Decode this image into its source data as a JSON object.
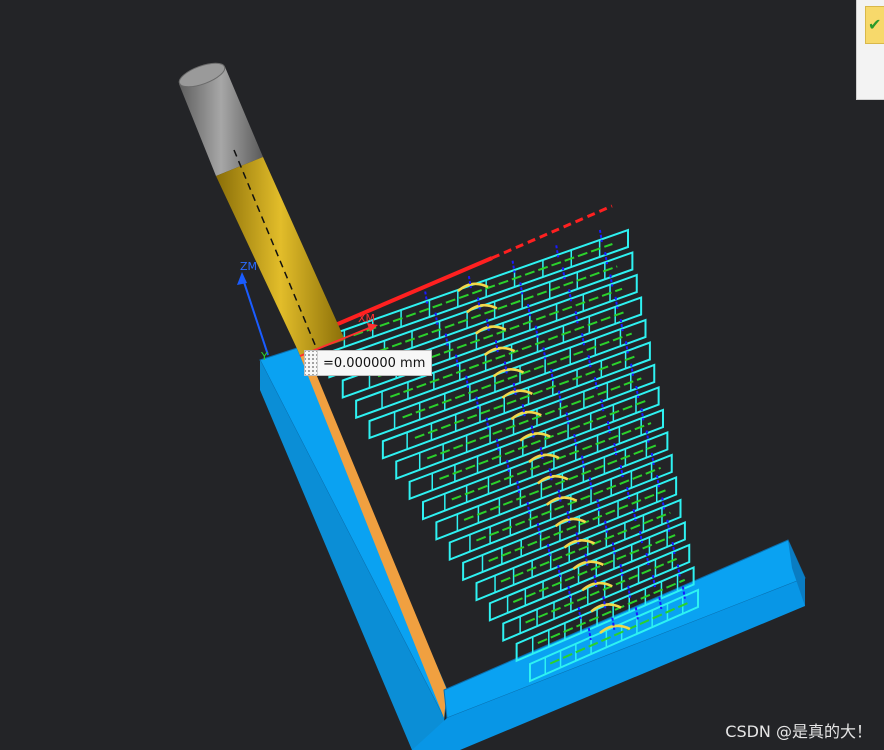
{
  "viewport": {
    "axis_z_label": "ZM",
    "axis_x_label": "XM",
    "axis_y_label": "Y"
  },
  "measure_tooltip": {
    "value": "=0.000000 mm"
  },
  "corner_panel": {
    "ok_icon": "check-icon"
  },
  "watermark": {
    "text": "CSDN @是真的大！"
  },
  "colors": {
    "background": "#232427",
    "workpiece": "#0aa2f2",
    "workpiece_edge": "#f0a040",
    "toolpath": "#2ef2f2",
    "feed_lines": "#2bd12b",
    "rapid_moves": "#1a1aff",
    "retract": "#ff2020",
    "tool_holder": "#7a7a7a",
    "tool_shank": "#c7a21a"
  }
}
